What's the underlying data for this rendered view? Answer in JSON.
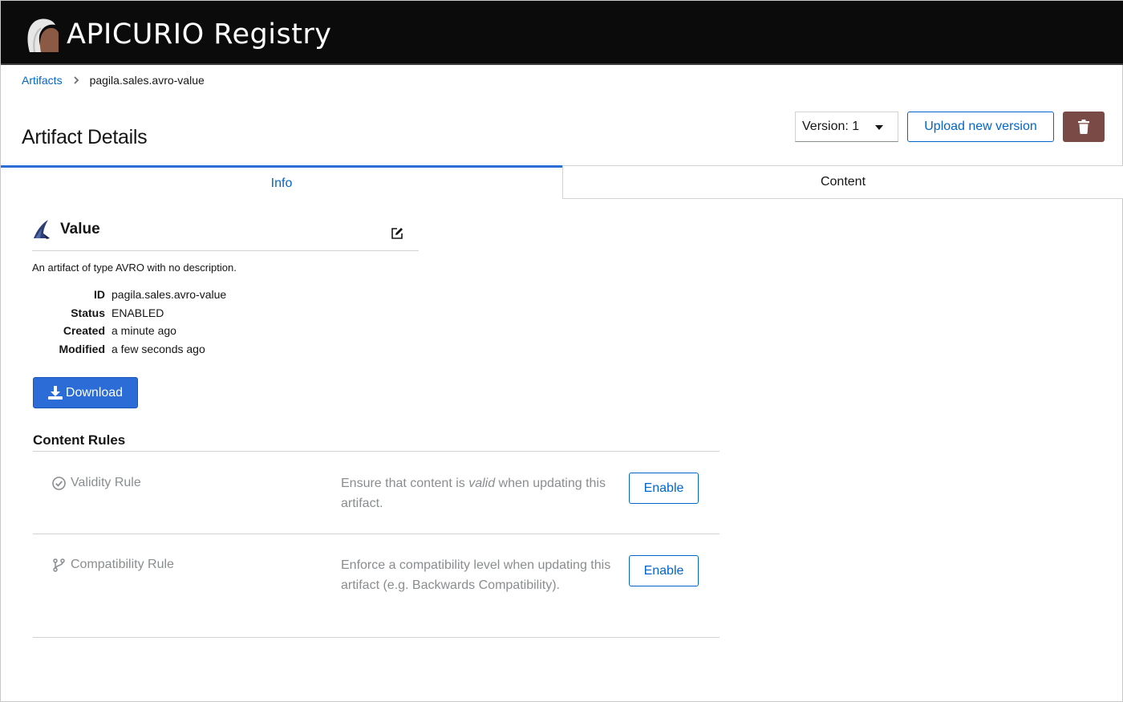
{
  "app": {
    "title": "APICURIO Registry"
  },
  "breadcrumb": {
    "root": "Artifacts",
    "current": "pagila.sales.avro-value"
  },
  "page": {
    "title": "Artifact Details"
  },
  "toolbar": {
    "version_label": "Version: 1",
    "upload_label": "Upload new version",
    "delete_icon": "trash-icon"
  },
  "tabs": [
    {
      "label": "Info",
      "active": true
    },
    {
      "label": "Content",
      "active": false
    }
  ],
  "artifact": {
    "type_icon": "avro-icon",
    "name": "Value",
    "description": "An artifact of type AVRO with no description.",
    "fields": [
      {
        "key": "ID",
        "value": "pagila.sales.avro-value"
      },
      {
        "key": "Status",
        "value": "ENABLED"
      },
      {
        "key": "Created",
        "value": "a minute ago"
      },
      {
        "key": "Modified",
        "value": "a few seconds ago"
      }
    ],
    "download_label": "Download"
  },
  "rules": {
    "title": "Content Rules",
    "items": [
      {
        "name": "Validity Rule",
        "icon": "check-circle-icon",
        "desc_before": "Ensure that content is ",
        "desc_em": "valid",
        "desc_after": " when updating this artifact.",
        "button": "Enable"
      },
      {
        "name": "Compatibility Rule",
        "icon": "code-branch-icon",
        "desc": "Enforce a compatibility level when updating this artifact (e.g. Backwards Compatibility).",
        "button": "Enable"
      }
    ]
  },
  "colors": {
    "masthead": "#0b0b0b",
    "link": "#0066cc",
    "primary": "#2b6cd6",
    "danger": "#7a4a47",
    "muted": "#8a8d90"
  }
}
